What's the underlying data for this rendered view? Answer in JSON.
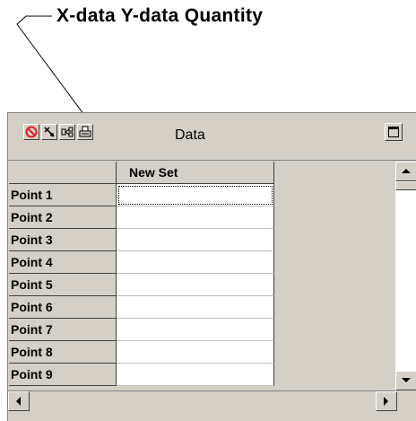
{
  "callout": {
    "text": "X-data  Y-data Quantity"
  },
  "window": {
    "title": "Data",
    "toolbar": [
      {
        "name": "cancel-icon"
      },
      {
        "name": "pick-icon"
      },
      {
        "name": "link-icon"
      },
      {
        "name": "print-icon"
      }
    ]
  },
  "table": {
    "column_header": "New Set",
    "rows": [
      {
        "label": "Point 1",
        "value": ""
      },
      {
        "label": "Point 2",
        "value": ""
      },
      {
        "label": "Point 3",
        "value": ""
      },
      {
        "label": "Point 4",
        "value": ""
      },
      {
        "label": "Point 5",
        "value": ""
      },
      {
        "label": "Point 6",
        "value": ""
      },
      {
        "label": "Point 7",
        "value": ""
      },
      {
        "label": "Point 8",
        "value": ""
      },
      {
        "label": "Point 9",
        "value": ""
      }
    ]
  },
  "colors": {
    "chrome": "#d4d0c8",
    "cancel_icon": "#e0202a"
  }
}
